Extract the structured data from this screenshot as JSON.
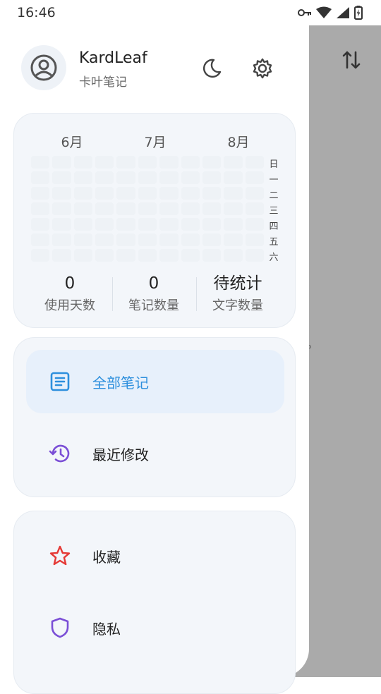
{
  "status_bar": {
    "time": "16:46"
  },
  "header": {
    "title": "KardLeaf",
    "subtitle": "卡叶笔记"
  },
  "heatmap": {
    "months": [
      "6月",
      "7月",
      "8月"
    ],
    "weekdays": [
      "日",
      "一",
      "二",
      "三",
      "四",
      "五",
      "六"
    ]
  },
  "stats": [
    {
      "value": "0",
      "label": "使用天数"
    },
    {
      "value": "0",
      "label": "笔记数量"
    },
    {
      "value": "待统计",
      "label": "文字数量"
    }
  ],
  "menu": {
    "group1": [
      {
        "label": "全部笔记",
        "icon": "notes-icon",
        "active": true,
        "color": "#2d8fdd"
      },
      {
        "label": "最近修改",
        "icon": "history-icon",
        "active": false,
        "color": "#7b4fd6"
      }
    ],
    "group2": [
      {
        "label": "收藏",
        "icon": "star-icon",
        "active": false,
        "color": "#e53935"
      },
      {
        "label": "隐私",
        "icon": "shield-icon",
        "active": false,
        "color": "#7b4fd6"
      }
    ]
  },
  "background": {
    "fragment": "。"
  },
  "colors": {
    "accent": "#2d8fdd",
    "card_bg": "#f3f6fa",
    "active_bg": "#e7f0fb"
  }
}
